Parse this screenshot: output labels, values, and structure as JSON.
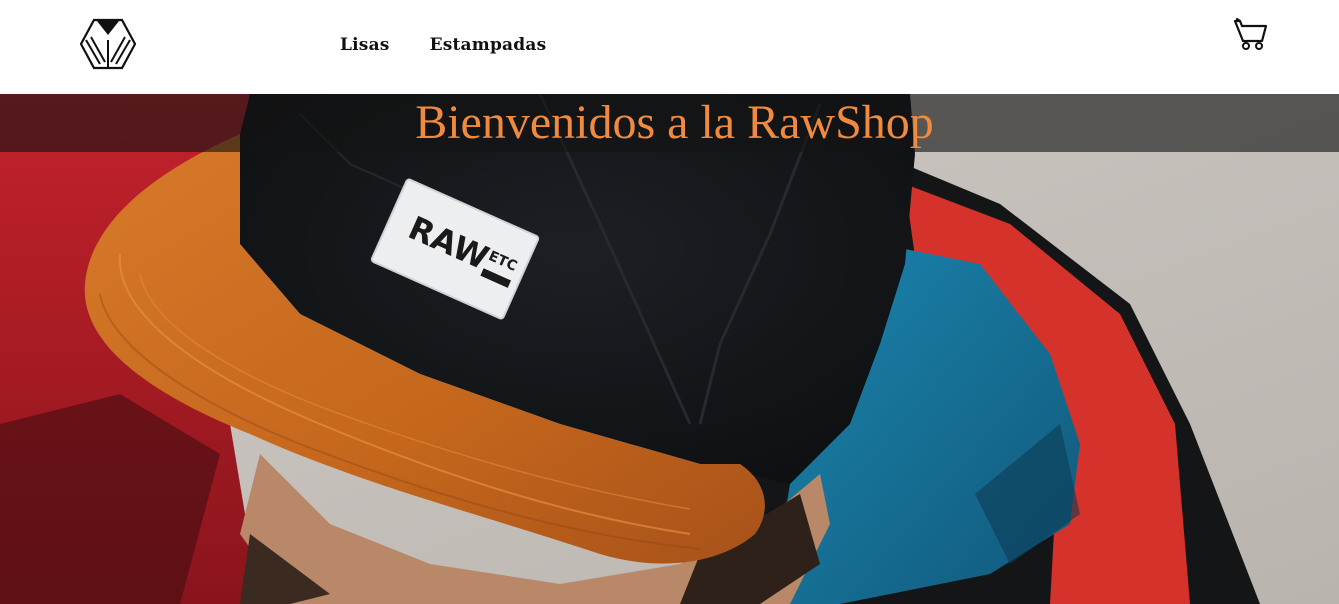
{
  "nav": {
    "logo_icon": "geometric-chevron-logo-icon",
    "links": [
      {
        "label": "Lisas"
      },
      {
        "label": "Estampadas"
      }
    ],
    "cart_icon": "shopping-cart-icon"
  },
  "hero": {
    "title": "Bienvenidos a la RawShop",
    "title_color": "#f08a3e",
    "image_alt": "Man wearing a black cap with an orange suede brim and a RAW ETC label, red and blue jacket",
    "cap_label": {
      "main": "RAW",
      "sub": "ETC"
    }
  }
}
